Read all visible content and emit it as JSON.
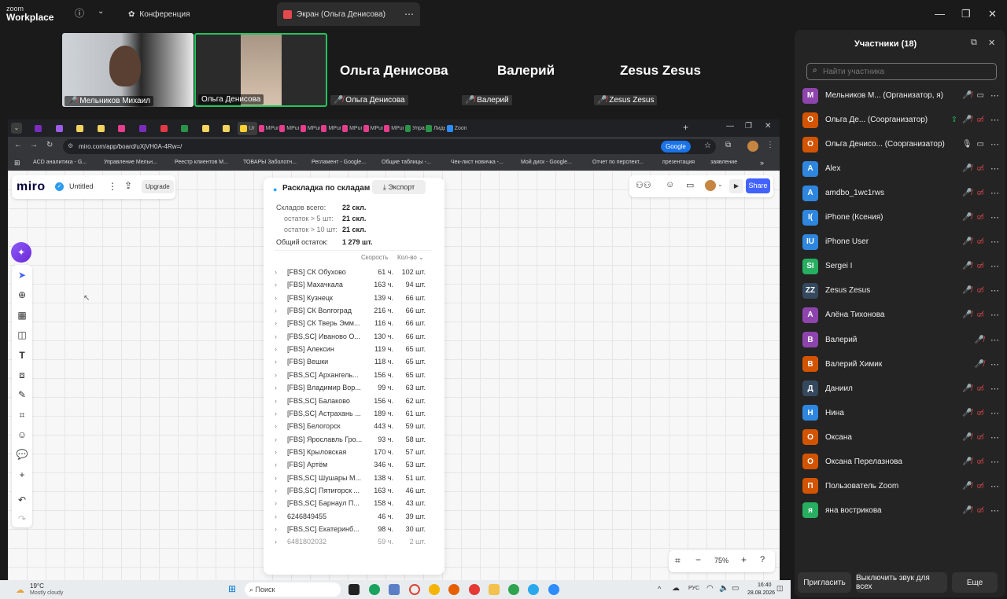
{
  "zoom": {
    "logo_small": "zoom",
    "logo_big": "Workplace",
    "tab_meeting": "Конференция",
    "tab_screen": "Экран (Ольга Денисова)"
  },
  "videos": [
    {
      "name": "Мельников Михаил"
    },
    {
      "name": "Ольга Денисова"
    }
  ],
  "names": [
    {
      "big": "Ольга Денисова",
      "small": "Ольга Денисова"
    },
    {
      "big": "Валерий",
      "small": "Валерий"
    },
    {
      "big": "Zesus Zesus",
      "small": "Zesus Zesus"
    }
  ],
  "browser": {
    "tabs": [
      {
        "label": "",
        "color": "#7b2cbf"
      },
      {
        "label": "",
        "color": "#9b5de5"
      },
      {
        "label": "",
        "color": "#f4d35e"
      },
      {
        "label": "",
        "color": "#f4d35e"
      },
      {
        "label": "",
        "color": "#e63e8c"
      },
      {
        "label": "",
        "color": "#7b2cbf"
      },
      {
        "label": "",
        "color": "#e63946"
      },
      {
        "label": "",
        "color": "#2b9348"
      },
      {
        "label": "",
        "color": "#f4d35e"
      },
      {
        "label": "",
        "color": "#f4d35e"
      },
      {
        "label": "Ur",
        "color": "#ffd02f"
      },
      {
        "label": "MPum",
        "color": "#e63e8c"
      },
      {
        "label": "MPum",
        "color": "#e63e8c"
      },
      {
        "label": "MPum",
        "color": "#e63e8c"
      },
      {
        "label": "MPum",
        "color": "#e63e8c"
      },
      {
        "label": "MPum",
        "color": "#e63e8c"
      },
      {
        "label": "MPum",
        "color": "#e63e8c"
      },
      {
        "label": "MPum",
        "color": "#e63e8c"
      },
      {
        "label": "Управ",
        "color": "#2b9348"
      },
      {
        "label": "Лиды",
        "color": "#2b9348"
      },
      {
        "label": "Zoom",
        "color": "#2d8cff"
      }
    ],
    "url": "miro.com/app/board/uXjVH0A-4Rw=/",
    "google_btn": "Google",
    "bookmarks": [
      "ACD аналитика - G...",
      "Управление Мельн...",
      "Реестр клиентов М...",
      "ТОВАРЫ Заболотн...",
      "Регламент - Google...",
      "Общие таблицы -...",
      "Чек-лист новичка -...",
      "Мой диск - Google...",
      "Отчет по перспект...",
      "презентация",
      "заявление"
    ]
  },
  "miro": {
    "logo": "miro",
    "board_name": "Untitled",
    "upgrade": "Upgrade",
    "share": "Share",
    "zoom": "75%"
  },
  "panel": {
    "title": "Раскладка по складам",
    "export": "Экспорт",
    "total_label": "Складов всего:",
    "total_value": "22 скл.",
    "gt5_label": "остаток > 5 шт:",
    "gt5_value": "21 скл.",
    "gt10_label": "остаток > 10 шт:",
    "gt10_value": "21 скл.",
    "stock_label": "Общий остаток:",
    "stock_value": "1 279 шт.",
    "col_speed": "Скорость",
    "col_qty": "Кол-во",
    "rows": [
      {
        "name": "[FBS] СК Обухово",
        "speed": "61 ч.",
        "qty": "102 шт."
      },
      {
        "name": "[FBS] Махачкала",
        "speed": "163 ч.",
        "qty": "94 шт."
      },
      {
        "name": "[FBS] Кузнецк",
        "speed": "139 ч.",
        "qty": "66 шт."
      },
      {
        "name": "[FBS] СК Волгоград",
        "speed": "216 ч.",
        "qty": "66 шт."
      },
      {
        "name": "[FBS] СК Тверь Эмм...",
        "speed": "116 ч.",
        "qty": "66 шт."
      },
      {
        "name": "[FBS,SC] Иваново О...",
        "speed": "130 ч.",
        "qty": "66 шт."
      },
      {
        "name": "[FBS] Алексин",
        "speed": "119 ч.",
        "qty": "65 шт."
      },
      {
        "name": "[FBS] Вешки",
        "speed": "118 ч.",
        "qty": "65 шт."
      },
      {
        "name": "[FBS,SC] Архангель...",
        "speed": "156 ч.",
        "qty": "65 шт."
      },
      {
        "name": "[FBS] Владимир Вор...",
        "speed": "99 ч.",
        "qty": "63 шт."
      },
      {
        "name": "[FBS,SC] Балаково",
        "speed": "156 ч.",
        "qty": "62 шт."
      },
      {
        "name": "[FBS,SC] Астрахань ...",
        "speed": "189 ч.",
        "qty": "61 шт."
      },
      {
        "name": "[FBS] Белогорск",
        "speed": "443 ч.",
        "qty": "59 шт."
      },
      {
        "name": "[FBS] Ярославль Гро...",
        "speed": "93 ч.",
        "qty": "58 шт."
      },
      {
        "name": "[FBS] Крыловская",
        "speed": "170 ч.",
        "qty": "57 шт."
      },
      {
        "name": "[FBS] Артём",
        "speed": "346 ч.",
        "qty": "53 шт."
      },
      {
        "name": "[FBS,SC] Шушары М...",
        "speed": "138 ч.",
        "qty": "51 шт."
      },
      {
        "name": "[FBS,SC] Пятигорск ...",
        "speed": "163 ч.",
        "qty": "46 шт."
      },
      {
        "name": "[FBS,SC] Барнаул П...",
        "speed": "158 ч.",
        "qty": "43 шт."
      },
      {
        "name": "6246849455",
        "speed": "46 ч.",
        "qty": "39 шт."
      },
      {
        "name": "[FBS,SC] Екатеринб...",
        "speed": "98 ч.",
        "qty": "30 шт."
      },
      {
        "name": "6481802032",
        "speed": "59 ч.",
        "qty": "2 шт."
      }
    ]
  },
  "taskbar": {
    "temp": "19°C",
    "weather": "Mostly cloudy",
    "search": "Поиск",
    "lang": "РУС",
    "time": "16:40",
    "date": "28.08.2026"
  },
  "participants": {
    "title": "Участники (18)",
    "search_placeholder": "Найти участника",
    "list": [
      {
        "initials": "М",
        "name": "Мельников М... (Организатор, я)",
        "color": "#8e44ad",
        "mic": "muted",
        "video": "on"
      },
      {
        "initials": "О",
        "name": "Ольга Де... (Соорганизатор)",
        "color": "#d35400",
        "mic": "muted",
        "video": "off",
        "share": true
      },
      {
        "initials": "О",
        "name": "Ольга Денисо... (Соорганизатор)",
        "color": "#d35400",
        "mic": "on",
        "video": "on"
      },
      {
        "initials": "A",
        "name": "Alex",
        "color": "#2e86de",
        "mic": "muted",
        "video": "off"
      },
      {
        "initials": "A",
        "name": "amdbo_1wc1rws",
        "color": "#2e86de",
        "mic": "muted",
        "video": "off"
      },
      {
        "initials": "I(",
        "name": "iPhone (Ксения)",
        "color": "#2e86de",
        "mic": "muted",
        "video": "off"
      },
      {
        "initials": "IU",
        "name": "iPhone User",
        "color": "#2e86de",
        "mic": "muted",
        "video": "off"
      },
      {
        "initials": "SI",
        "name": "Sergei I",
        "color": "#27ae60",
        "mic": "muted",
        "video": "off"
      },
      {
        "initials": "ZZ",
        "name": "Zesus Zesus",
        "color": "#34495e",
        "mic": "muted",
        "video": "off"
      },
      {
        "initials": "А",
        "name": "Алёна Тихонова",
        "color": "#8e44ad",
        "mic": "muted",
        "video": "off"
      },
      {
        "initials": "В",
        "name": "Валерий",
        "color": "#8e44ad",
        "mic": "muted",
        "video": "none"
      },
      {
        "initials": "В",
        "name": "Валерий Химик",
        "color": "#d35400",
        "mic": "muted",
        "video": "none"
      },
      {
        "initials": "Д",
        "name": "Даниил",
        "color": "#34495e",
        "mic": "muted",
        "video": "off"
      },
      {
        "initials": "Н",
        "name": "Нина",
        "color": "#2e86de",
        "mic": "muted",
        "video": "off"
      },
      {
        "initials": "О",
        "name": "Оксана",
        "color": "#d35400",
        "mic": "muted",
        "video": "off"
      },
      {
        "initials": "О",
        "name": "Оксана Перелазнова",
        "color": "#d35400",
        "mic": "muted",
        "video": "off"
      },
      {
        "initials": "П",
        "name": "Пользователь Zoom",
        "color": "#d35400",
        "mic": "muted",
        "video": "off"
      },
      {
        "initials": "я",
        "name": "яна вострикова",
        "color": "#27ae60",
        "mic": "muted",
        "video": "off"
      }
    ],
    "invite": "Пригласить",
    "mute_all": "Выключить звук для всех",
    "more": "Еще"
  }
}
